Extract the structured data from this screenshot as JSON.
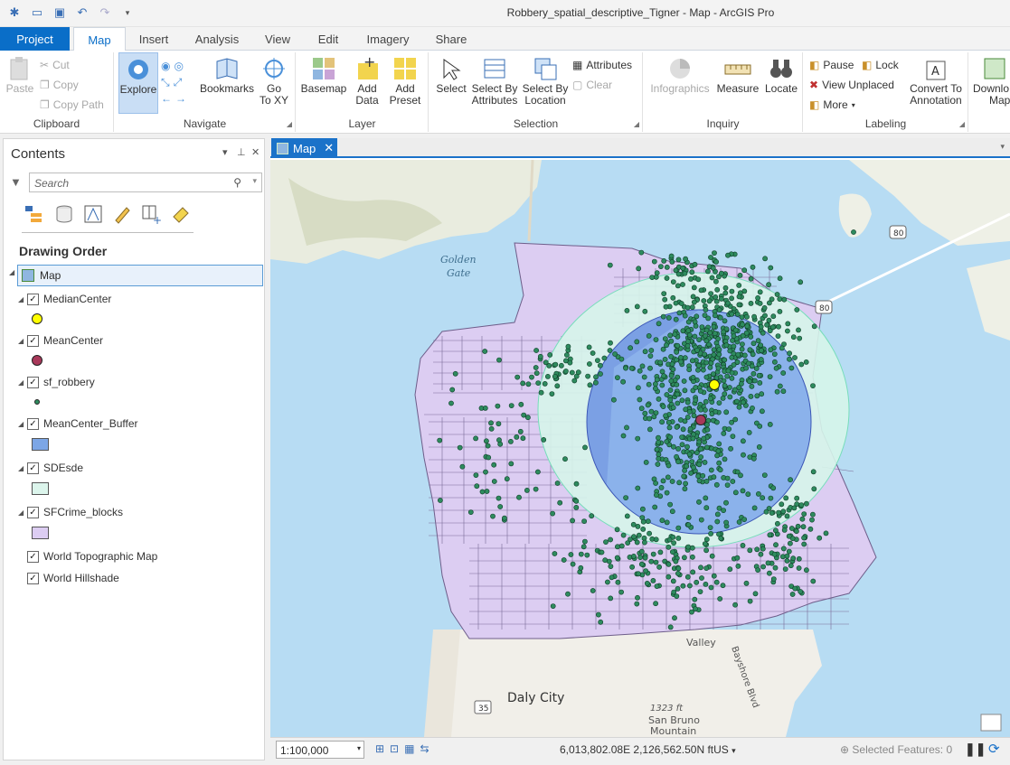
{
  "window": {
    "title": "Robbery_spatial_descriptive_Tigner - Map - ArcGIS Pro"
  },
  "quick_access": [
    "new-project-icon",
    "open-project-icon",
    "save-project-icon",
    "undo-icon",
    "redo-icon",
    "customize-icon"
  ],
  "tabs": [
    "Project",
    "Map",
    "Insert",
    "Analysis",
    "View",
    "Edit",
    "Imagery",
    "Share"
  ],
  "active_tab": "Map",
  "ribbon": {
    "clipboard": {
      "label": "Clipboard",
      "paste": "Paste",
      "cut": "Cut",
      "copy": "Copy",
      "copy_path": "Copy Path"
    },
    "navigate": {
      "label": "Navigate",
      "explore": "Explore",
      "bookmarks": "Bookmarks",
      "goto_line1": "Go",
      "goto_line2": "To XY"
    },
    "layer": {
      "label": "Layer",
      "basemap": "Basemap",
      "add_data_line1": "Add",
      "add_data_line2": "Data",
      "add_preset_line1": "Add",
      "add_preset_line2": "Preset"
    },
    "selection": {
      "label": "Selection",
      "select": "Select",
      "by_attr_line1": "Select By",
      "by_attr_line2": "Attributes",
      "by_loc_line1": "Select By",
      "by_loc_line2": "Location",
      "attributes": "Attributes",
      "clear": "Clear"
    },
    "inquiry": {
      "label": "Inquiry",
      "infographics": "Infographics",
      "measure": "Measure",
      "locate": "Locate"
    },
    "labeling": {
      "label": "Labeling",
      "pause": "Pause",
      "lock": "Lock",
      "view_unplaced": "View Unplaced",
      "more": "More",
      "convert_line1": "Convert To",
      "convert_line2": "Annotation"
    },
    "offline": {
      "download_line1": "Downlo",
      "download_line2": "Map"
    }
  },
  "contents": {
    "title": "Contents",
    "search_placeholder": "Search",
    "drawing_order": "Drawing Order",
    "map_label": "Map",
    "layers": [
      {
        "name": "MedianCenter",
        "symbol": "yellow-point",
        "color": "#ffff00"
      },
      {
        "name": "MeanCenter",
        "symbol": "maroon-point",
        "color": "#a8385a"
      },
      {
        "name": "sf_robbery",
        "symbol": "green-point",
        "color": "#2e8b5e"
      },
      {
        "name": "MeanCenter_Buffer",
        "symbol": "blue-polygon",
        "color": "#7ca6e6"
      },
      {
        "name": "SDEsde",
        "symbol": "mint-polygon",
        "color": "#dcf5ec"
      },
      {
        "name": "SFCrime_blocks",
        "symbol": "lavender-polygon",
        "color": "#dccdf2"
      },
      {
        "name": "World Topographic Map",
        "symbol": "none"
      },
      {
        "name": "World Hillshade",
        "symbol": "none"
      }
    ]
  },
  "map": {
    "tab_label": "Map",
    "labels": {
      "golden_gate_1": "Golden",
      "golden_gate_2": "Gate",
      "daly_city": "Daly City",
      "valley": "Valley",
      "bayshore": "Bayshore Blvd",
      "san_bruno_1": "San Bruno",
      "san_bruno_2": "Mountain",
      "elevation": "1323 ft",
      "hwy80": "80",
      "hwy35": "35"
    },
    "colors": {
      "water": "#b7dcf3",
      "land": "#f1efe9",
      "blocks": "#dccdf2",
      "sde": "#d6f5ea",
      "buffer": "#7ea7eb",
      "points": "#2e8b5e"
    }
  },
  "status": {
    "scale": "1:100,000",
    "coordinates": "6,013,802.08E 2,126,562.50N ftUS",
    "selected_features": "Selected Features: 0"
  }
}
